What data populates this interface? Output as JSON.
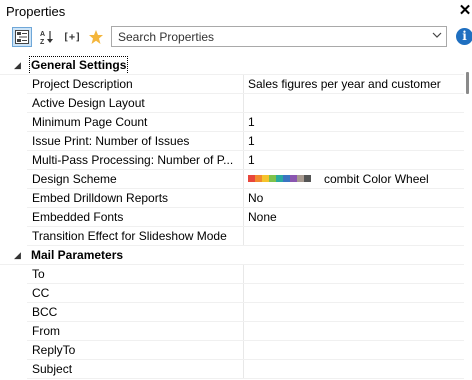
{
  "window": {
    "title": "Properties",
    "close": "✕"
  },
  "toolbar": {
    "search_placeholder": "Search Properties",
    "expression_label": "[+]",
    "info_glyph": "i",
    "icons": [
      "categorized-view-icon",
      "sort-alphabetical-icon",
      "expression-icon",
      "favorites-star-icon",
      "info-icon"
    ]
  },
  "categories": [
    {
      "name": "General Settings",
      "properties": [
        {
          "label": "Project Description",
          "value": "Sales figures per year and customer"
        },
        {
          "label": "Active Design Layout",
          "value": ""
        },
        {
          "label": "Minimum Page Count",
          "value": "1"
        },
        {
          "label": "Issue Print: Number of Issues",
          "value": "1"
        },
        {
          "label": "Multi-Pass Processing: Number of P...",
          "value": "1"
        },
        {
          "label": "Design Scheme",
          "value": "combit Color Wheel"
        },
        {
          "label": "Embed Drilldown Reports",
          "value": "No"
        },
        {
          "label": "Embedded Fonts",
          "value": "None"
        },
        {
          "label": "Transition Effect for Slideshow Mode",
          "value": ""
        }
      ]
    },
    {
      "name": "Mail Parameters",
      "properties": [
        {
          "label": "To",
          "value": ""
        },
        {
          "label": "CC",
          "value": ""
        },
        {
          "label": "BCC",
          "value": ""
        },
        {
          "label": "From",
          "value": ""
        },
        {
          "label": "ReplyTo",
          "value": ""
        },
        {
          "label": "Subject",
          "value": ""
        }
      ]
    }
  ],
  "design_scheme_colors": [
    "#e8463c",
    "#f28a2e",
    "#f5c32c",
    "#7fc24b",
    "#2aa9a0",
    "#3b74c2",
    "#8a56b0",
    "#a89a90",
    "#555555"
  ],
  "colors": {
    "accent": "#1f6fc0",
    "selected_button": "#cde4f7"
  }
}
